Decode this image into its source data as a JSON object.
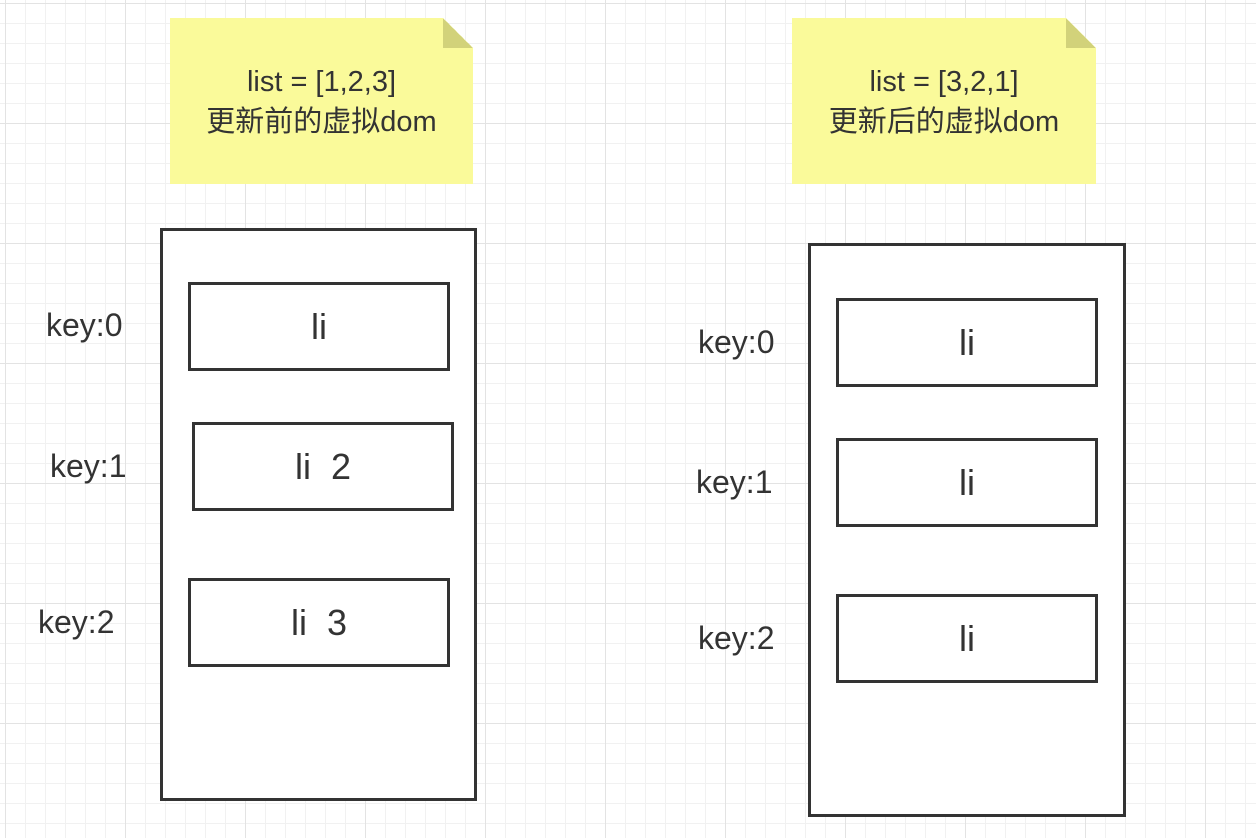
{
  "before": {
    "note": {
      "line1": "list = [1,2,3]",
      "line2": "更新前的虚拟dom"
    },
    "keys": [
      "key:0",
      "key:1",
      "key:2"
    ],
    "items": [
      "li",
      "li  2",
      "li  3"
    ]
  },
  "after": {
    "note": {
      "line1": "list = [3,2,1]",
      "line2": "更新后的虚拟dom"
    },
    "keys": [
      "key:0",
      "key:1",
      "key:2"
    ],
    "items": [
      "li",
      "li",
      "li"
    ]
  },
  "colors": {
    "note_fill": "#fafa9a",
    "stroke": "#333333",
    "grid": "#e3e3e3"
  }
}
